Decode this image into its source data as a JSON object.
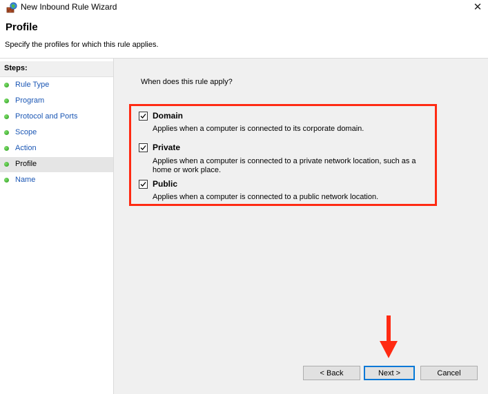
{
  "window": {
    "title": "New Inbound Rule Wizard",
    "close_glyph": "✕"
  },
  "header": {
    "title": "Profile",
    "description": "Specify the profiles for which this rule applies."
  },
  "steps": {
    "heading": "Steps:",
    "items": [
      {
        "label": "Rule Type",
        "current": false
      },
      {
        "label": "Program",
        "current": false
      },
      {
        "label": "Protocol and Ports",
        "current": false
      },
      {
        "label": "Scope",
        "current": false
      },
      {
        "label": "Action",
        "current": false
      },
      {
        "label": "Profile",
        "current": true
      },
      {
        "label": "Name",
        "current": false
      }
    ]
  },
  "main": {
    "question": "When does this rule apply?",
    "options": [
      {
        "name": "Domain",
        "checked": true,
        "description": "Applies when a computer is connected to its corporate domain."
      },
      {
        "name": "Private",
        "checked": true,
        "description": "Applies when a computer is connected to a private network location, such as a home or work place."
      },
      {
        "name": "Public",
        "checked": true,
        "description": "Applies when a computer is connected to a public network location."
      }
    ]
  },
  "buttons": {
    "back": "< Back",
    "next": "Next >",
    "cancel": "Cancel"
  },
  "colors": {
    "highlight": "#ff2a12",
    "accent": "#0078d7",
    "link": "#1a56b4"
  }
}
